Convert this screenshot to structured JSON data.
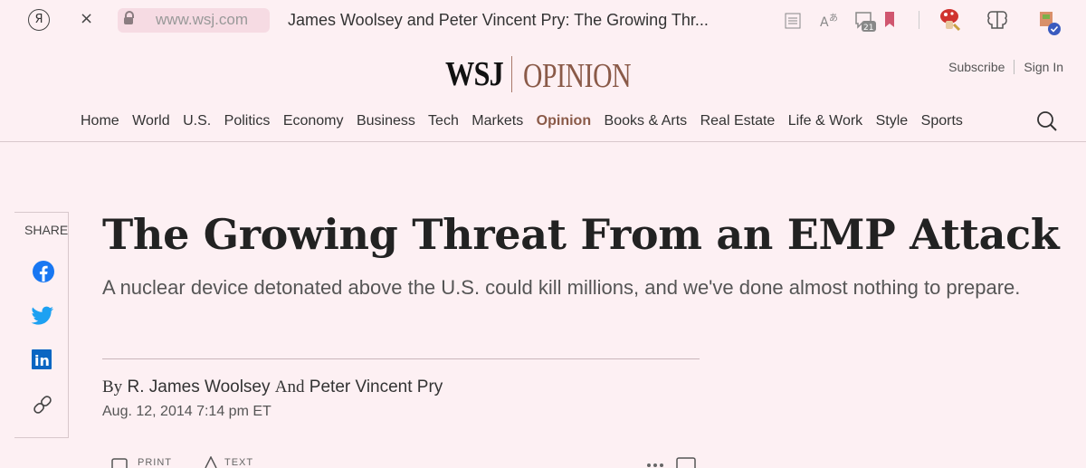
{
  "browser": {
    "yandex_glyph": "Я",
    "close_glyph": "×",
    "url": "www.wsj.com",
    "tab_title": "James Woolsey and Peter Vincent Pry: The Growing Thr...",
    "badge_count": "21"
  },
  "header": {
    "logo": "WSJ",
    "section_logo": "OPINION",
    "subscribe": "Subscribe",
    "sign_in": "Sign In"
  },
  "nav": {
    "items": [
      "Home",
      "World",
      "U.S.",
      "Politics",
      "Economy",
      "Business",
      "Tech",
      "Markets",
      "Opinion",
      "Books & Arts",
      "Real Estate",
      "Life & Work",
      "Style",
      "Sports"
    ],
    "active": "Opinion"
  },
  "share": {
    "label": "SHARE"
  },
  "article": {
    "headline": "The Growing Threat From an EMP Attack",
    "dek": "A nuclear device detonated above the U.S. could kill millions, and we've done almost nothing to prepare.",
    "by_prefix": "By",
    "author1": "R. James Woolsey",
    "and": "And",
    "author2": "Peter Vincent Pry",
    "date": "Aug. 12, 2014 7:14 pm ET",
    "print_label": "PRINT",
    "text_label": "TEXT"
  },
  "colors": {
    "background": "#fdf0f3",
    "opinion_accent": "#8a5a48",
    "facebook": "#1877f2",
    "twitter": "#1da1f2",
    "linkedin": "#0a66c2"
  }
}
